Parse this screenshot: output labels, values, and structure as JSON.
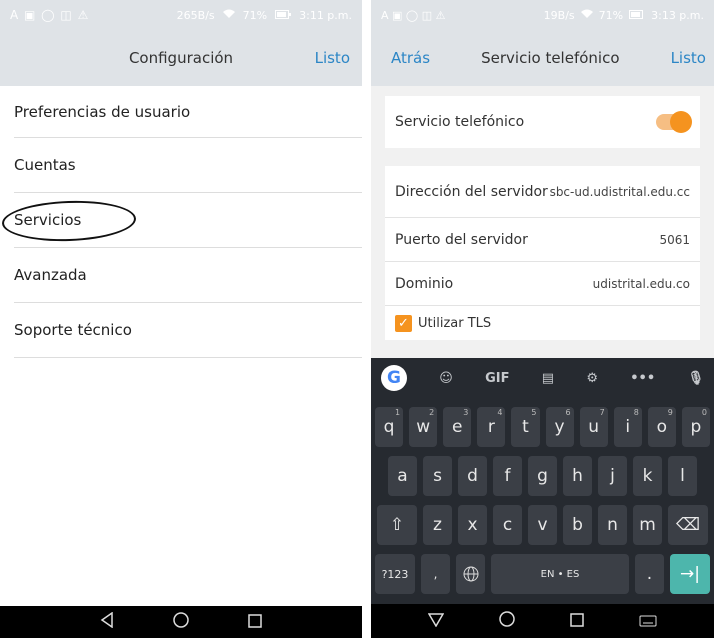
{
  "left": {
    "status": {
      "icons": "A ▣ ◯ ◫ ⚠",
      "speed": "265B/s",
      "battery": "71%",
      "time": "3:11 p.m."
    },
    "nav": {
      "title": "Configuración",
      "done": "Listo"
    },
    "menu": [
      {
        "label": "Preferencias de usuario"
      },
      {
        "label": "Cuentas"
      },
      {
        "label": "Servicios"
      },
      {
        "label": "Avanzada"
      },
      {
        "label": "Soporte técnico"
      }
    ]
  },
  "right": {
    "status": {
      "icons": "A ▣ ◯ ◫ ⚠",
      "speed": "19B/s",
      "battery": "71%",
      "time": "3:13 p.m."
    },
    "nav": {
      "back": "Atrás",
      "title": "Servicio telefónico",
      "done": "Listo"
    },
    "toggle_label": "Servicio telefónico",
    "fields": [
      {
        "label": "Dirección del servidor",
        "value": "sbc-ud.udistrital.edu.cc"
      },
      {
        "label": "Puerto del servidor",
        "value": "5061"
      },
      {
        "label": "Dominio",
        "value": "udistrital.edu.co"
      }
    ],
    "tls_label": "Utilizar TLS",
    "keyboard": {
      "toolbar": [
        "G",
        "☺",
        "GIF",
        "▤",
        "⚙",
        "•••",
        "🎙"
      ],
      "row1": [
        {
          "k": "q",
          "s": "1"
        },
        {
          "k": "w",
          "s": "2"
        },
        {
          "k": "e",
          "s": "3"
        },
        {
          "k": "r",
          "s": "4"
        },
        {
          "k": "t",
          "s": "5"
        },
        {
          "k": "y",
          "s": "6"
        },
        {
          "k": "u",
          "s": "7"
        },
        {
          "k": "i",
          "s": "8"
        },
        {
          "k": "o",
          "s": "9"
        },
        {
          "k": "p",
          "s": "0"
        }
      ],
      "row2": [
        "a",
        "s",
        "d",
        "f",
        "g",
        "h",
        "j",
        "k",
        "l"
      ],
      "row3": [
        "z",
        "x",
        "c",
        "v",
        "b",
        "n",
        "m"
      ],
      "symbols": "?123",
      "space": "EN • ES",
      "period": ".",
      "enter": "→|"
    }
  },
  "colors": {
    "accent": "#2c86c6",
    "orange": "#f5931f",
    "keyboard_bg": "#262a30"
  }
}
